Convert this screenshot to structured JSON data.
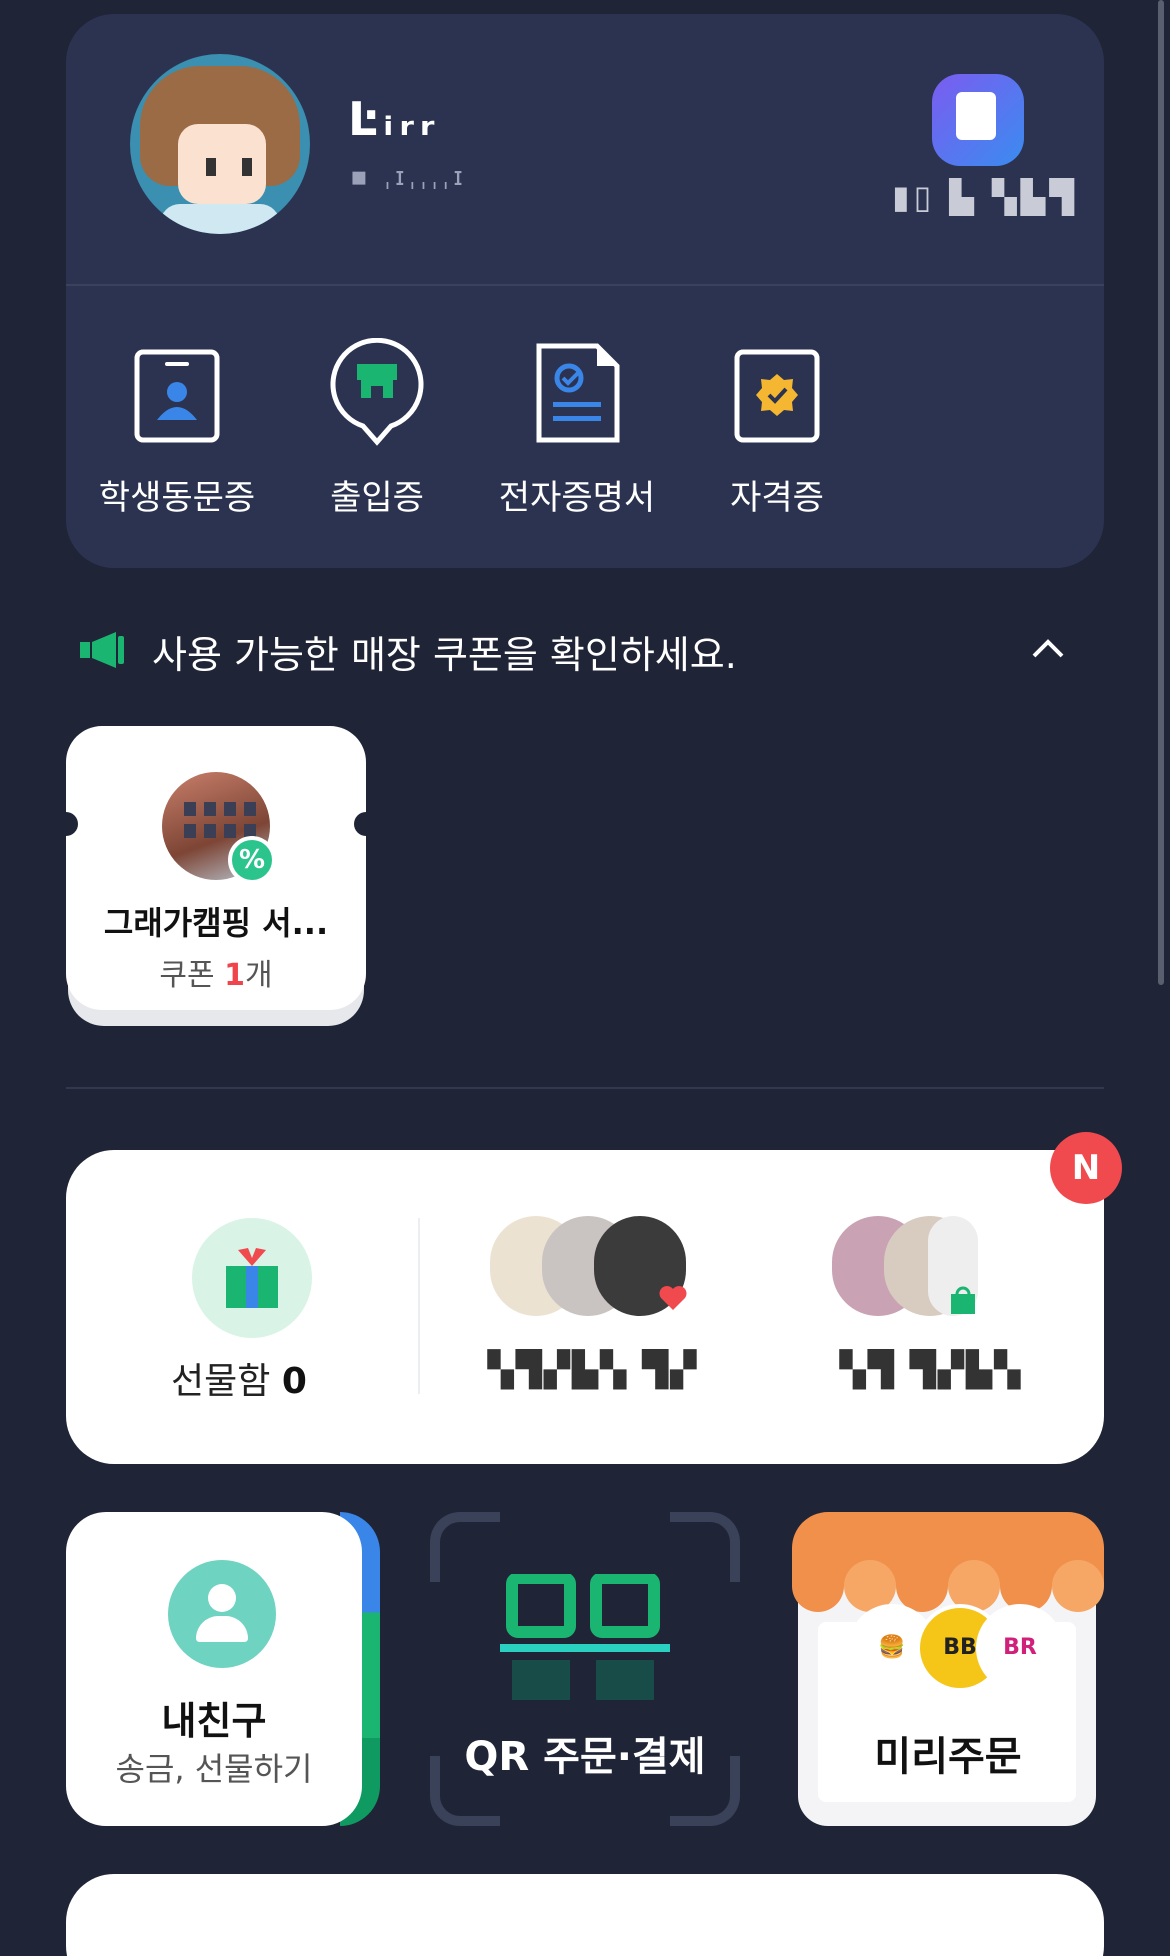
{
  "profile": {
    "name": "Ŀᵢᵣᵣ",
    "sub": "▪ ˌɪˌˌˌˌɪ",
    "point_text": "▮▯ ▙ ▚▙▜",
    "quick_menu": [
      {
        "label": "학생동문증",
        "icon": "student-id-icon"
      },
      {
        "label": "출입증",
        "icon": "access-pass-icon"
      },
      {
        "label": "전자증명서",
        "icon": "e-certificate-icon"
      },
      {
        "label": "자격증",
        "icon": "license-icon"
      }
    ]
  },
  "notice": {
    "text": "사용 가능한 매장 쿠폰을 확인하세요.",
    "icon": "megaphone-icon",
    "toggle_icon": "chevron-up-icon"
  },
  "coupons": [
    {
      "store": "그래가캠핑 서...",
      "count_prefix": "쿠폰 ",
      "count": "1",
      "count_suffix": "개",
      "badge": "%"
    }
  ],
  "gift": {
    "new_badge": "N",
    "box_label": "선물함",
    "box_count": "0",
    "col2_label": "▚▜▞▙▚ ▜▞",
    "col3_label": "▚▜ ▜▞▙▚"
  },
  "tiles": {
    "friend": {
      "title": "내친구",
      "subtitle": "송금, 선물하기"
    },
    "qr": {
      "title": "QR 주문·결제"
    },
    "preorder": {
      "title": "미리주문",
      "brands": [
        "burger",
        "BB",
        "BR"
      ]
    }
  },
  "colors": {
    "background": "#1f2436",
    "card": "#2c3350",
    "accent_green": "#1bb572",
    "accent_red": "#f04a4f"
  }
}
